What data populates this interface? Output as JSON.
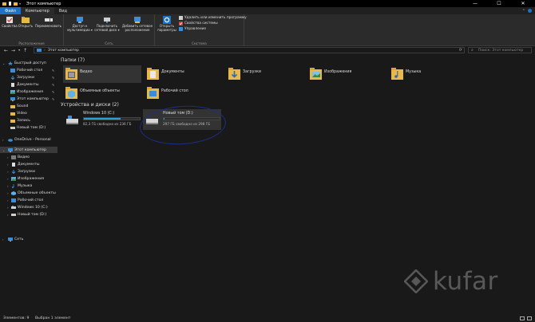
{
  "window": {
    "title": "Этот компьютер",
    "controls": [
      "—",
      "☐",
      "✕"
    ]
  },
  "ribbon_tabs": [
    {
      "label": "Файл",
      "kind": "file"
    },
    {
      "label": "Компьютер",
      "kind": "active"
    },
    {
      "label": "Вид",
      "kind": "normal"
    }
  ],
  "ribbon": {
    "location": {
      "label": "Расположение",
      "buttons": [
        "Свойства",
        "Открыть",
        "Переименовать"
      ]
    },
    "network": {
      "label": "Сеть",
      "buttons": [
        "Доступ к мультимедиа ▾",
        "Подключить сетевой диск ▾",
        "Добавить сетевое расположение"
      ]
    },
    "system": {
      "label": "Система",
      "open_settings": "Открыть параметры",
      "small": [
        "Удалить или изменить программу",
        "Свойства системы",
        "Управление"
      ]
    }
  },
  "address": {
    "path": "Этот компьютер",
    "search_placeholder": "Поиск: Этот компьютер"
  },
  "sidebar": {
    "quick_access": "Быстрый доступ",
    "quick_items": [
      "Рабочий стол",
      "Загрузки",
      "Документы",
      "Изображения",
      "Этот компьютер",
      "Sound",
      "Video",
      "Запись",
      "Новый том (D:)"
    ],
    "onedrive": "OneDrive - Personal",
    "this_pc": "Этот компьютер",
    "pc_items": [
      "Видео",
      "Документы",
      "Загрузки",
      "Изображения",
      "Музыка",
      "Объемные объекты",
      "Рабочий стол",
      "Windows 10 (C:)",
      "Новый том (D:)"
    ],
    "network": "Сеть"
  },
  "content": {
    "folders_header": "Папки (7)",
    "folders": [
      "Видео",
      "Документы",
      "Загрузки",
      "Изображения",
      "Музыка",
      "Объемные объекты",
      "Рабочий стол"
    ],
    "drives_header": "Устройства и диски (2)",
    "drives": [
      {
        "name": "Windows 10 (C:)",
        "free": "82,3 ГБ свободно из 236 ГБ",
        "used_fraction": 0.65,
        "color": "#26a0da"
      },
      {
        "name": "Новый том (D:)",
        "free": "297 ГБ свободно из 298 ГБ",
        "used_fraction": 0.01,
        "color": "#26a0da"
      }
    ]
  },
  "watermark": "kufar",
  "status": {
    "count": "Элементов: 9",
    "selected": "Выбран 1 элемент"
  },
  "colors": {
    "accent": "#1a73c8",
    "folder": "#e8b84a",
    "annotation": "#1c2e8c"
  }
}
